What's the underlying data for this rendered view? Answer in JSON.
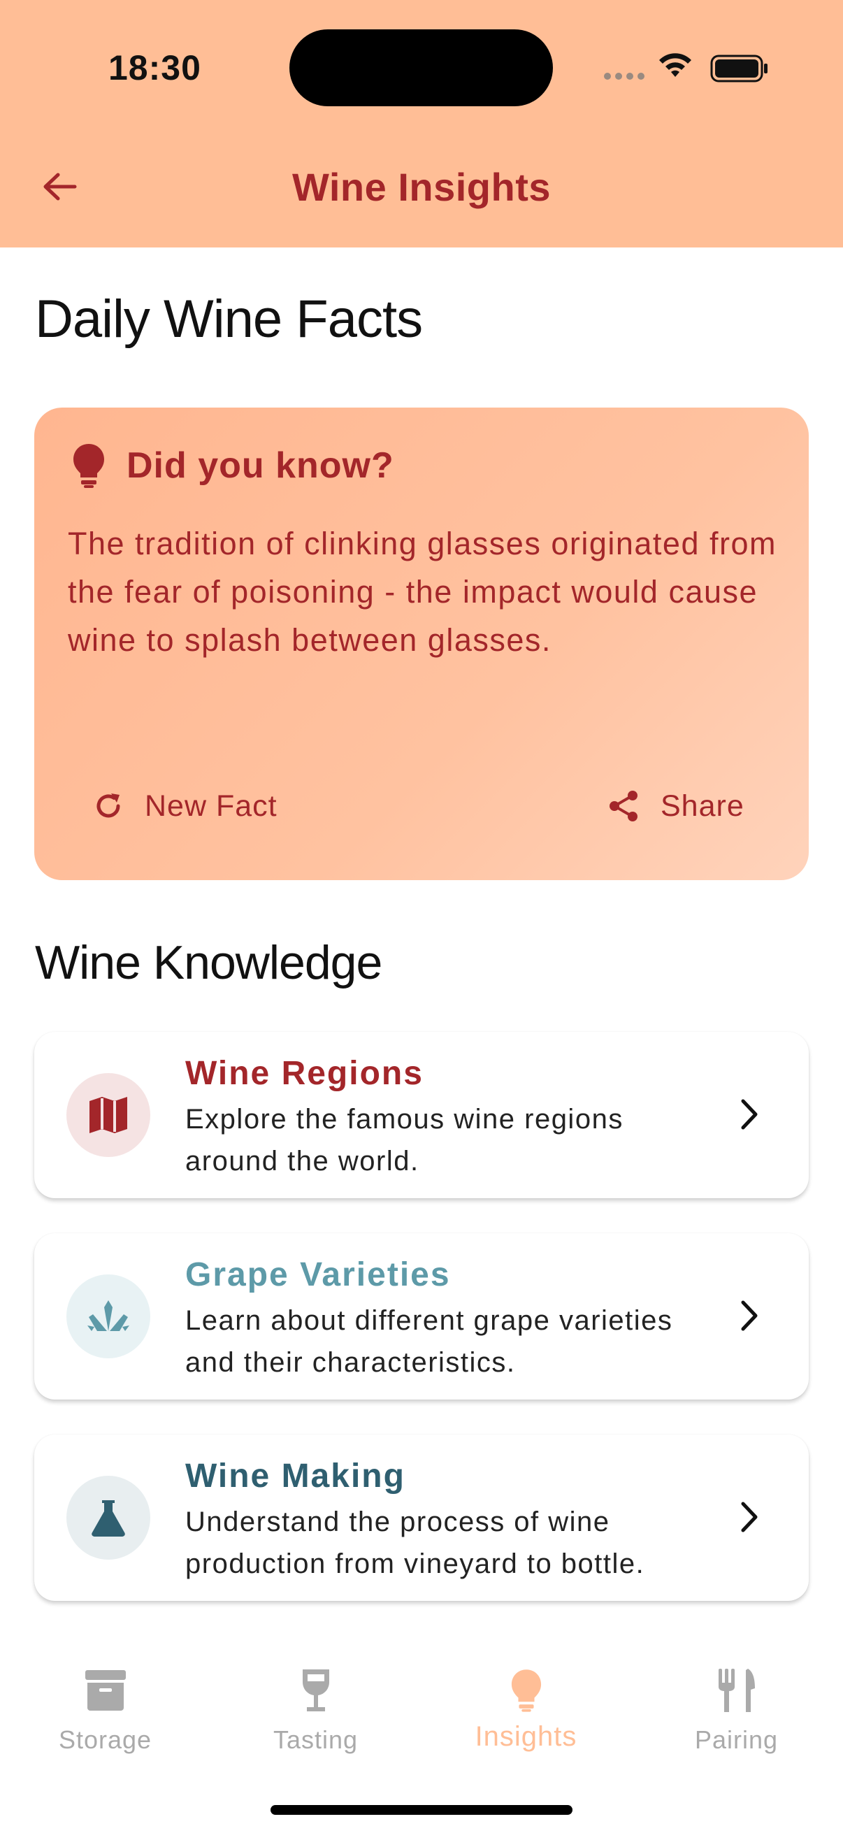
{
  "status_bar": {
    "time": "18:30"
  },
  "header": {
    "title": "Wine Insights"
  },
  "sections": {
    "daily_title": "Daily Wine Facts",
    "knowledge_title": "Wine Knowledge"
  },
  "fact_card": {
    "title": "Did you know?",
    "text": "The tradition of clinking glasses originated from the fear of poisoning - the impact would cause wine to splash between glasses.",
    "new_fact_label": "New Fact",
    "share_label": "Share"
  },
  "knowledge": [
    {
      "title": "Wine Regions",
      "description": "Explore the famous wine regions around the world.",
      "color": "#A3262A",
      "icon": "map-icon"
    },
    {
      "title": "Grape Varieties",
      "description": "Learn about different grape varieties and their characteristics.",
      "color": "#5D9AA8",
      "icon": "grape-leaf-icon"
    },
    {
      "title": "Wine Making",
      "description": "Understand the process of wine production from vineyard to bottle.",
      "color": "#2F5F70",
      "icon": "flask-icon"
    }
  ],
  "bottom_nav": [
    {
      "label": "Storage",
      "icon": "archive-icon"
    },
    {
      "label": "Tasting",
      "icon": "wine-glass-icon"
    },
    {
      "label": "Insights",
      "icon": "lightbulb-icon",
      "active": true
    },
    {
      "label": "Pairing",
      "icon": "fork-knife-icon"
    }
  ],
  "colors": {
    "accent": "#A3262A",
    "header_bg": "#FFBE96",
    "inactive": "#AAAAAA"
  }
}
